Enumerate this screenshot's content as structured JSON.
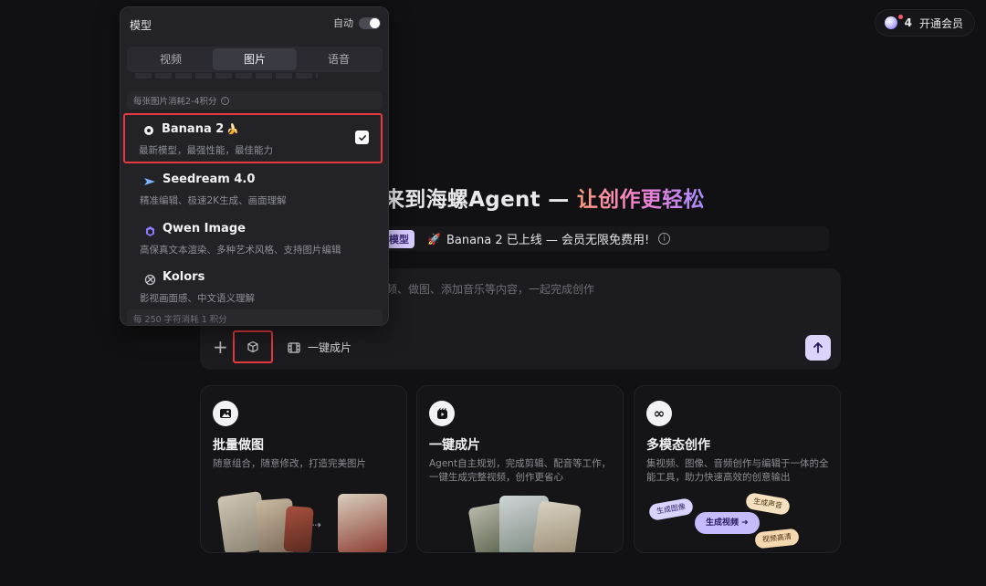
{
  "topbar": {
    "credits": "4",
    "vip_label": "开通会员"
  },
  "hero": {
    "title_main": "来到海螺Agent —",
    "title_accent": "让创作更轻松"
  },
  "announce": {
    "tag": "模型",
    "text": "Banana 2 已上线 — 会员无限免费用!",
    "info": "i"
  },
  "composer": {
    "placeholder": "频、做图、添加音乐等内容，一起完成创作",
    "oneclick_label": "一键成片"
  },
  "cards": [
    {
      "title": "批量做图",
      "desc": "随意组合，随意修改，打造完美图片"
    },
    {
      "title": "一键成片",
      "desc": "Agent自主规划，完成剪辑、配音等工作，一键生成完整视频，创作更省心"
    },
    {
      "title": "多模态创作",
      "desc": "集视频、图像、音频创作与编辑于一体的全能工具，助力快速高效的创意输出"
    }
  ],
  "multimodal_chips": {
    "image": "生成图像",
    "video": "生成视频",
    "voice": "生成声音",
    "hd": "视频高清"
  },
  "dropdown": {
    "header": "模型",
    "auto_label": "自动",
    "tabs": [
      "视频",
      "图片",
      "语音"
    ],
    "active_tab": "图片",
    "section": "每张图片消耗2-4积分",
    "items": [
      {
        "name": "Banana 2",
        "emoji": "🍌",
        "desc": "最新模型，最强性能，最佳能力",
        "selected": true
      },
      {
        "name": "Seedream 4.0",
        "desc": "精准编辑、极速2K生成、画面理解"
      },
      {
        "name": "Qwen Image",
        "desc": "高保真文本渲染、多种艺术风格、支持图片编辑"
      },
      {
        "name": "Kolors",
        "desc": "影视画面感、中文语义理解"
      }
    ],
    "footer": "每 250 字符消耗 1 积分"
  },
  "colors": {
    "accent": "#ddd3ff",
    "highlight": "#e5393f",
    "background": "#111113"
  }
}
